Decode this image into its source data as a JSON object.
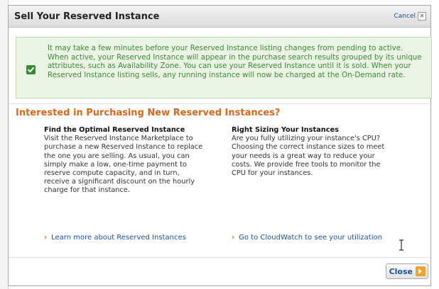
{
  "dialog": {
    "title": "Sell Your Reserved Instance",
    "cancel_label": "Cancel",
    "notice": "It may take a few minutes before your Reserved Instance listing changes from pending to active. When active, your Reserved Instance will appear in the purchase search results grouped by its unique attributes, such as Availability Zone. You can use your Reserved Instance until it is sold. When your Reserved Instance listing sells, any running instance will now be charged at the On-Demand rate.",
    "promo_heading": "Interested in Purchasing New Reserved Instances?",
    "columns": [
      {
        "title": "Find the Optimal Reserved Instance",
        "body": "Visit the Reserved Instance Marketplace to purchase a new Reserved Instance to replace the one you are selling. As usual, you can simply make a low, one-time payment to reserve compute capacity, and in turn, receive a significant discount on the hourly charge for that instance.",
        "link": "Learn more about Reserved Instances"
      },
      {
        "title": "Right Sizing Your Instances",
        "body": "Are you fully utilizing your instance's CPU? Choosing the correct instance sizes to meet your needs is a great way to reduce your costs. We provide free tools to monitor the CPU for your instances.",
        "link": "Go to CloudWatch to see your utilization"
      }
    ],
    "close_label": "Close"
  },
  "icons": {
    "check": "check-icon",
    "close_x": "close-x-icon",
    "link_chevron": "chevron-right-icon",
    "close_arrow": "arrow-right-icon",
    "cursor": "text-cursor-icon"
  },
  "colors": {
    "accent_orange": "#d9661a",
    "link_blue": "#1b4f9c",
    "notice_green": "#3c8b3c",
    "notice_bg": "#ebf4e4"
  }
}
